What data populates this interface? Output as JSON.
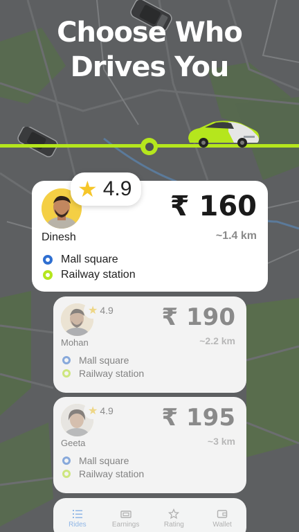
{
  "headline": {
    "line1": "Choose Who",
    "line2": "Drives You"
  },
  "colors": {
    "accent": "#b5e61d",
    "pickup_dot": "#2f6fd1",
    "star": "#f6c629",
    "map_bg": "#5f6163"
  },
  "drivers": [
    {
      "name": "Dinesh",
      "rating": "4.9",
      "price": "₹ 160",
      "distance": "~1.4 km",
      "pickup": "Mall square",
      "dropoff": "Railway station"
    },
    {
      "name": "Mohan",
      "rating": "4.9",
      "price": "₹ 190",
      "distance": "~2.2 km",
      "pickup": "Mall square",
      "dropoff": "Railway station"
    },
    {
      "name": "Geeta",
      "rating": "4.9",
      "price": "₹ 195",
      "distance": "~3 km",
      "pickup": "Mall square",
      "dropoff": "Railway station"
    }
  ],
  "nav": {
    "items": [
      {
        "label": "Rides",
        "icon": "list-icon",
        "active": true
      },
      {
        "label": "Earnings",
        "icon": "wallet-cash-icon",
        "active": false
      },
      {
        "label": "Rating",
        "icon": "star-icon",
        "active": false
      },
      {
        "label": "Wallet",
        "icon": "wallet-icon",
        "active": false
      }
    ]
  }
}
